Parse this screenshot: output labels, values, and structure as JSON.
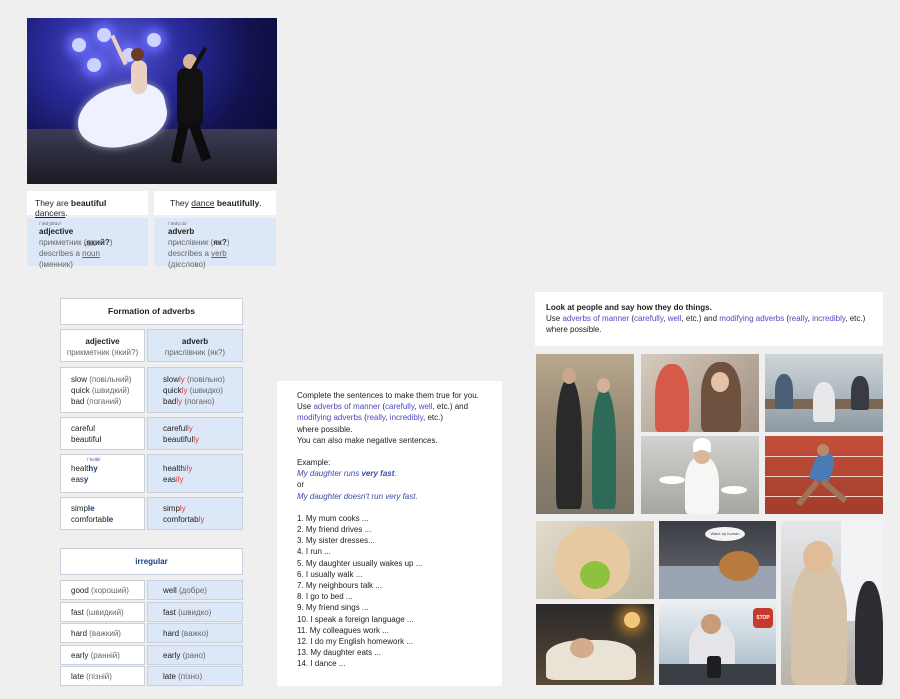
{
  "top_panel": {
    "sentence_adjective": {
      "before": "They are ",
      "bold": "beautiful",
      "space": " ",
      "underlined": "dancers",
      "end": "."
    },
    "sentence_adverb": {
      "before": "They ",
      "underlined": "dance",
      "space": " ",
      "bold": "beautifully",
      "end": "."
    },
    "adjective_box": {
      "transcription": "/ˈædʒɪktɪv/",
      "term": "adjective",
      "line1_prefix": "прикметник (",
      "line1_bold": "який?",
      "line1_suffix": ")",
      "line2_prefix": "describes a ",
      "line2_underlined": "noun",
      "line2_suffix": " (іменник)",
      "noun_transcription": "/naʊn/"
    },
    "adverb_box": {
      "transcription": "/ˈædvɜːb/",
      "term": "adverb",
      "line1_prefix": "прислівник (",
      "line1_bold": "як?",
      "line1_suffix": ")",
      "line2_prefix": "describes a ",
      "line2_underlined": "verb",
      "line2_suffix": " (дієслово)"
    }
  },
  "formation": {
    "title": "Formation of adverbs",
    "header_adjective": "adjective",
    "header_adjective_ua": "прикметник (який?)",
    "header_adverb": "adverb",
    "header_adverb_ua": "прислівник (як?)",
    "group1": {
      "adjectives": [
        {
          "word": "slow",
          "ua": " (повільний)"
        },
        {
          "word": "quick",
          "ua": " (швидкий)"
        },
        {
          "word": "bad",
          "ua": " (поганий)"
        }
      ],
      "adverbs": [
        {
          "stem": "slow",
          "suffix": "ly",
          "ua": " (повільно)"
        },
        {
          "stem": "quick",
          "suffix": "ly",
          "ua": " (швидко)"
        },
        {
          "stem": "bad",
          "suffix": "ly",
          "ua": " (погано)"
        }
      ]
    },
    "group2": {
      "adjectives": [
        "careful",
        "beautiful"
      ],
      "adverbs": [
        {
          "stem": "careful",
          "suffix": "ly"
        },
        {
          "stem": "beautiful",
          "suffix": "ly"
        }
      ]
    },
    "group3": {
      "transcription": "/ˈhelθi/",
      "adjectives": [
        {
          "stem": "healt",
          "ending": "hy"
        },
        {
          "stem": "eas",
          "ending": "y"
        }
      ],
      "adverbs": [
        {
          "stem": "health",
          "suffix": "ily"
        },
        {
          "stem": "eas",
          "suffix": "ily"
        }
      ]
    },
    "group4": {
      "adjectives": [
        {
          "stem": "simp",
          "ending": "le"
        },
        {
          "stem": "comfortab",
          "ending": "le"
        }
      ],
      "adverbs": [
        {
          "stem": "simp",
          "suffix": "ly"
        },
        {
          "stem": "comfortab",
          "suffix": "ly"
        }
      ]
    },
    "irregular_title": "irregular",
    "irregular": [
      {
        "adj": "good",
        "adj_ua": " (хороший)",
        "adv": "well",
        "adv_ua": " (добре)"
      },
      {
        "adj": "fast",
        "adj_ua": " (швидкий)",
        "adv": "fast",
        "adv_ua": " (швидко)"
      },
      {
        "adj": "hard",
        "adj_ua": " (важкий)",
        "adv": "hard",
        "adv_ua": " (важко)"
      },
      {
        "adj": "early",
        "adj_ua": " (ранній)",
        "adv": "early",
        "adv_ua": " (рано)"
      },
      {
        "adj": "late",
        "adj_ua": " (пізній)",
        "adv": "late",
        "adv_ua": " (пізно)"
      }
    ]
  },
  "exercise": {
    "line1": "Complete the sentences to make them true for you.",
    "line2_prefix": "Use ",
    "line2_link": "adverbs of manner",
    "line2_open": " (",
    "line2_ex1": "carefully",
    "line2_comma": ", ",
    "line2_ex2": "well",
    "line2_suffix": ", etc.) and",
    "line3_link": "modifying adverbs",
    "line3_open": " (",
    "line3_ex1": "really",
    "line3_comma": ", ",
    "line3_ex2": "incredibly",
    "line3_suffix": ", etc.)",
    "line4": "where possible.",
    "line5": "You can also make negative sentences.",
    "example_label": "Example:",
    "example1_prefix": "My daughter runs ",
    "example1_bold": "very fast",
    "example1_suffix": ".",
    "or": "or",
    "example2": "My daughter  doesn't run very fast.",
    "items": [
      "1. My mum cooks ...",
      "2. My friend drives ...",
      "3. My sister dresses...",
      "4. I run ...",
      "5. My daughter usually wakes up ...",
      "6. I usually walk ...",
      "7. My neighbours talk ...",
      "8. I go to bed ...",
      "9. My friend sings ...",
      "10. I speak a foreign language ...",
      "11. My colleagues work ...",
      "12. I do my English homework ...",
      "13. My daughter eats ...",
      "14. I dance ..."
    ]
  },
  "task": {
    "line1": "Look at people and say how they do things.",
    "line2_prefix": "Use ",
    "line2_link1": "adverbs of manner",
    "line2_open1": " (",
    "line2_ex1": "carefully",
    "line2_comma1": ", ",
    "line2_ex2": "well",
    "line2_mid": ", etc.) and ",
    "line2_link2": "modifying adverbs",
    "line2_open2": " (",
    "line2_ex3": "really",
    "line2_comma2": ", ",
    "line2_ex4": "incredibly",
    "line2_suffix": ", etc.)",
    "line3": "where possible."
  },
  "photos": {
    "speech_bubble": "Wake up human",
    "stop_sign": "STOP"
  },
  "colors": {
    "background": "#efefef",
    "blue_box": "#dce8f7",
    "suffix_red": "#e23b3b",
    "link_purple": "#4b4bbf",
    "example_blue": "#3b4ba8"
  }
}
